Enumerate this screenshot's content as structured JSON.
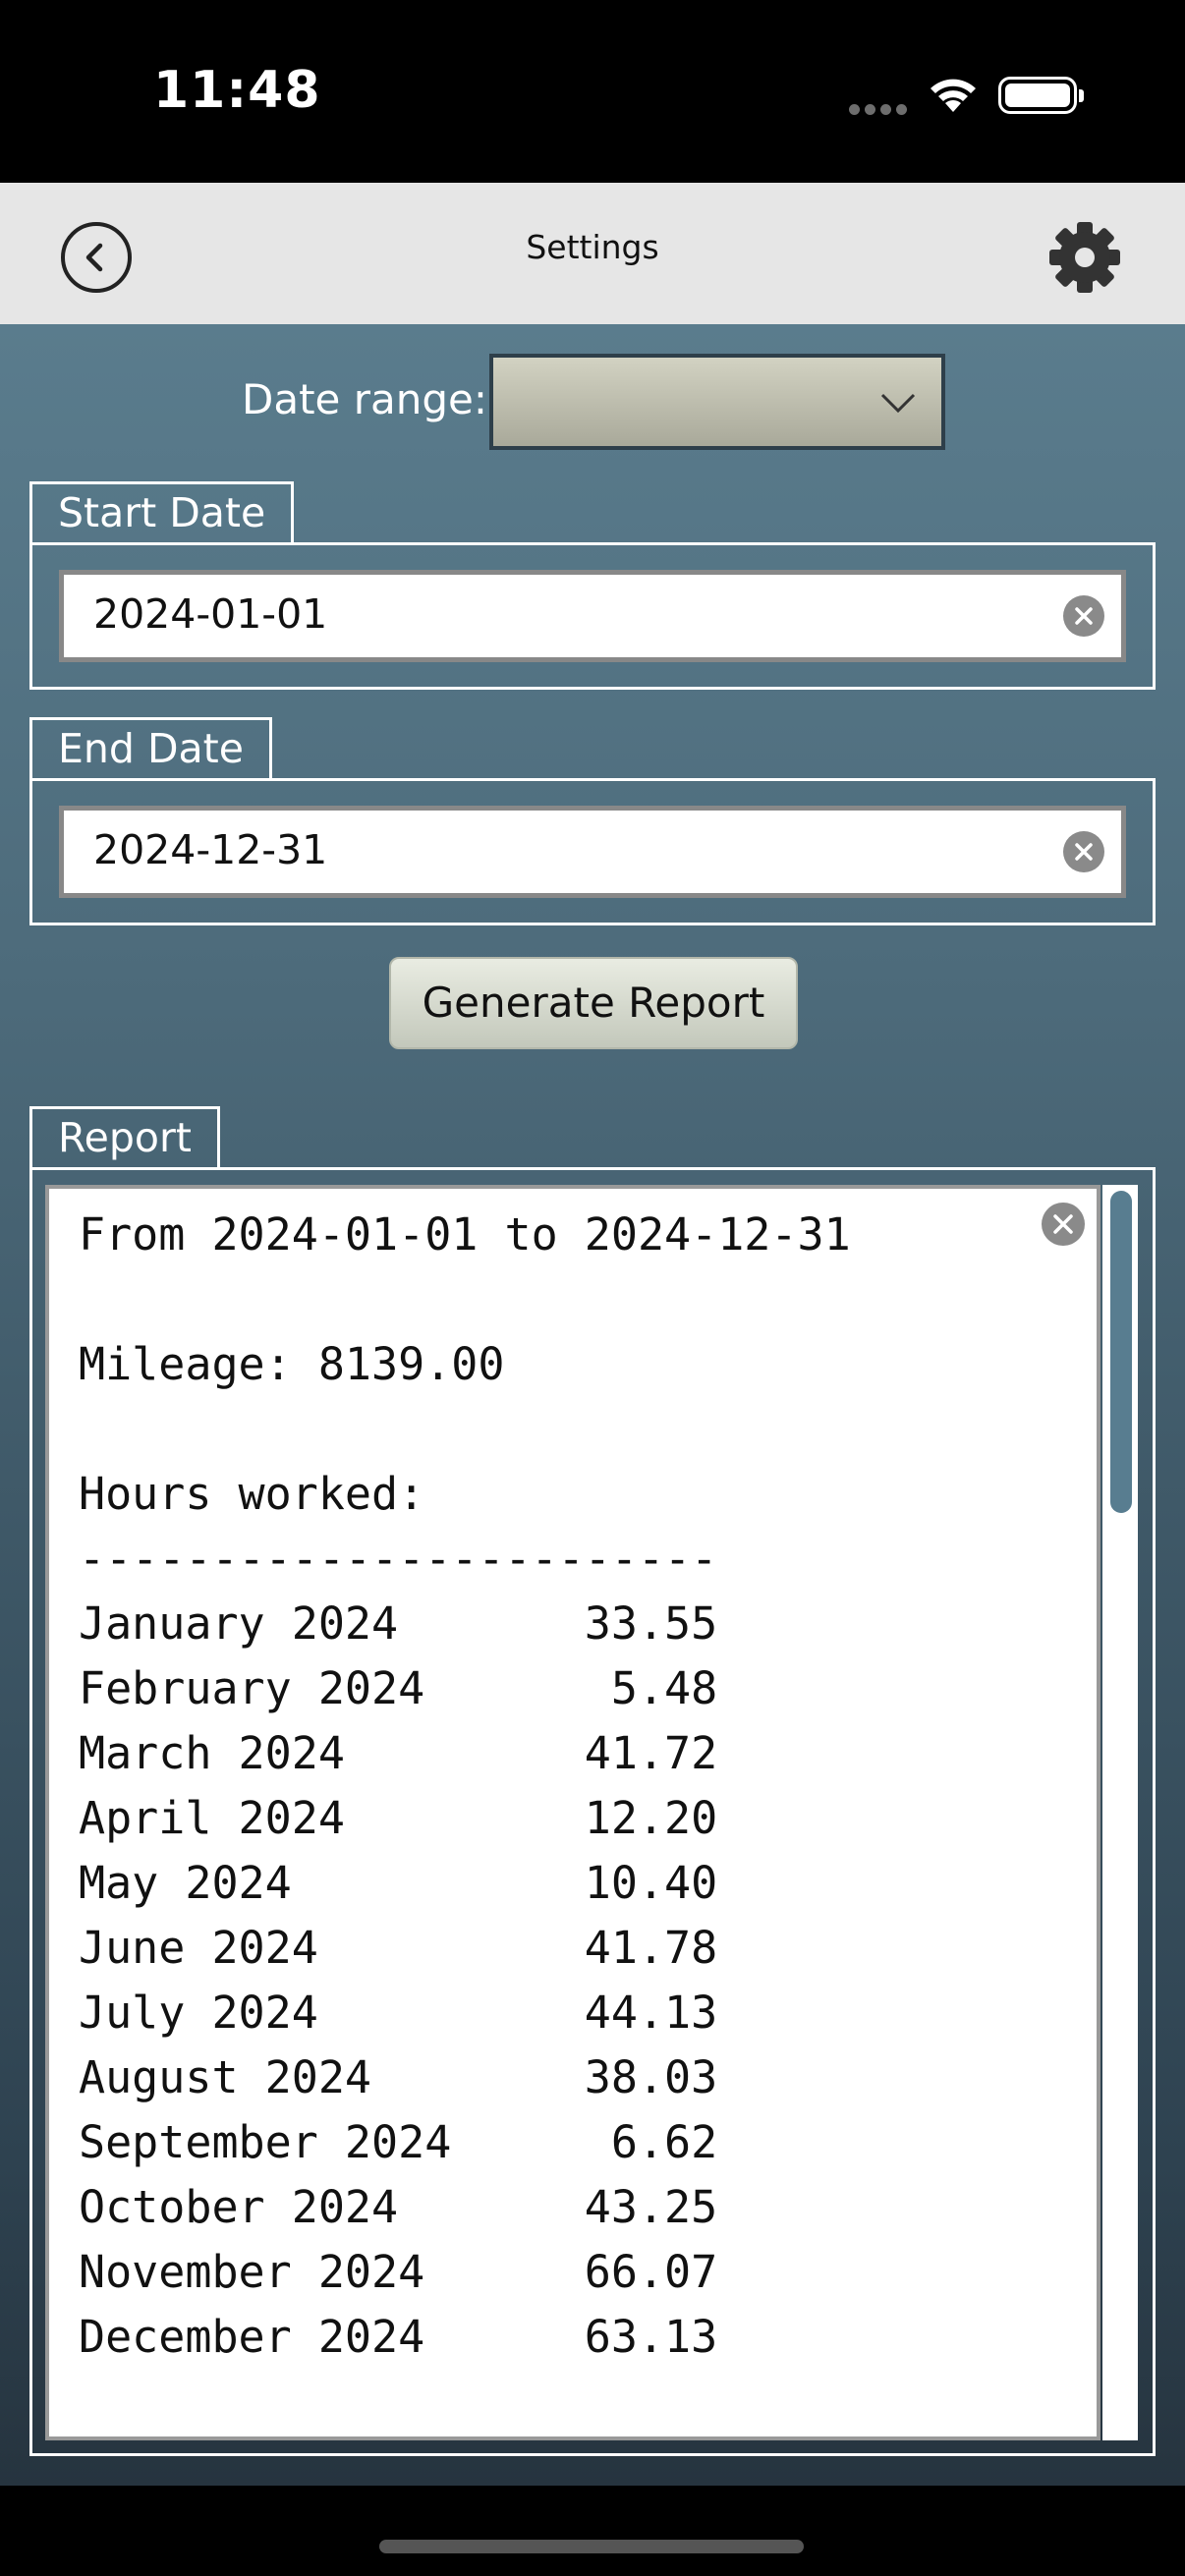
{
  "status_bar": {
    "time": "11:48"
  },
  "header": {
    "title": "Settings"
  },
  "date_range": {
    "label": "Date range:",
    "selected": ""
  },
  "start_date": {
    "legend": "Start Date",
    "value": "2024-01-01"
  },
  "end_date": {
    "legend": "End Date",
    "value": "2024-12-31"
  },
  "generate_button": {
    "label": "Generate Report"
  },
  "report": {
    "legend": "Report",
    "text": "From 2024-01-01 to 2024-12-31\n\nMileage: 8139.00\n\nHours worked:\n------------------------\nJanuary 2024       33.55\nFebruary 2024       5.48\nMarch 2024         41.72\nApril 2024         12.20\nMay 2024           10.40\nJune 2024          41.78\nJuly 2024          44.13\nAugust 2024        38.03\nSeptember 2024      6.62\nOctober 2024       43.25\nNovember 2024      66.07\nDecember 2024      63.13"
  },
  "icons": {
    "back": "back-circle-icon",
    "settings": "gear-icon",
    "dropdown": "chevron-down-icon",
    "clear": "clear-icon"
  }
}
